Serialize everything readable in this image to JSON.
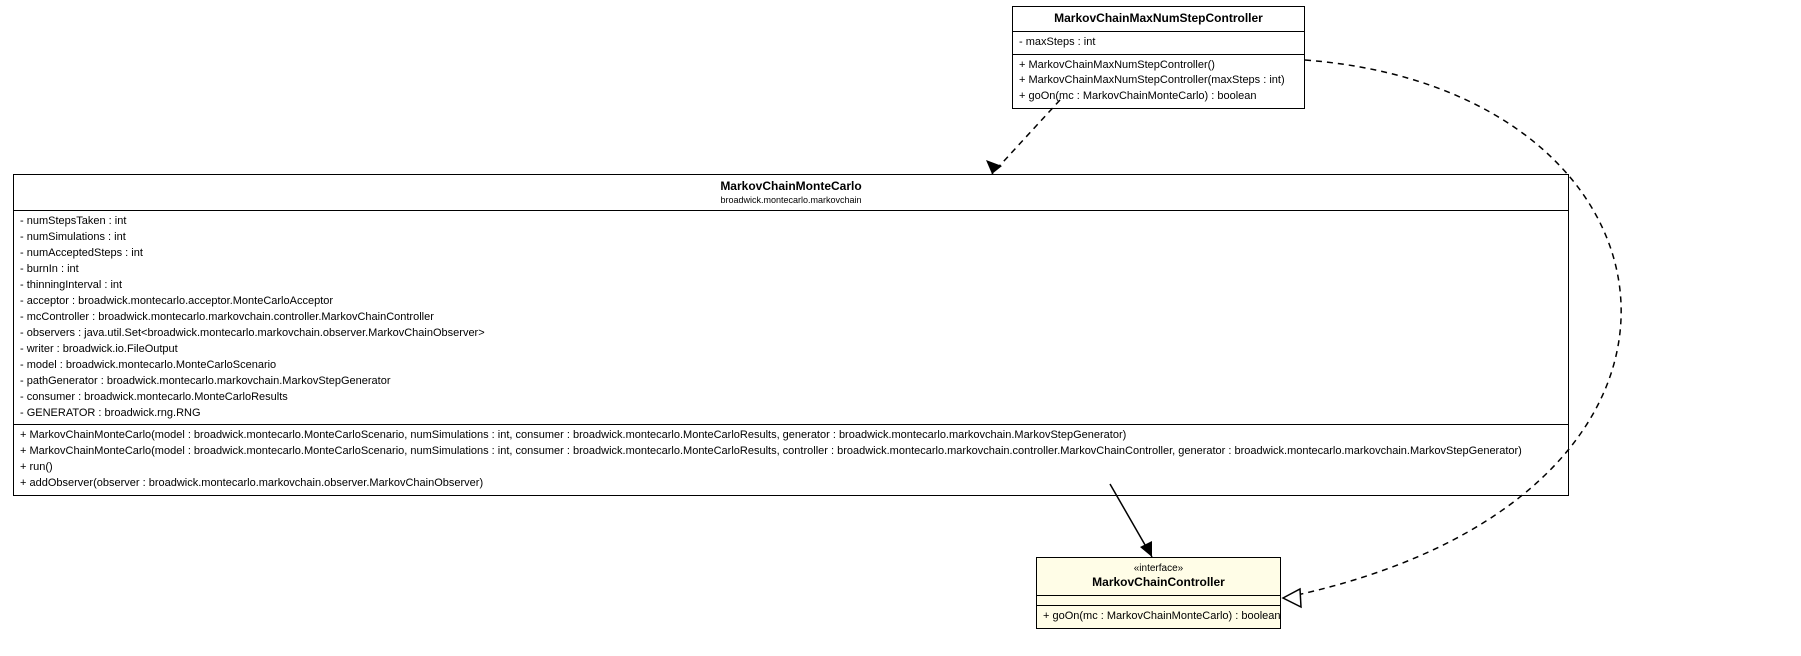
{
  "classes": {
    "maxStep": {
      "name": "MarkovChainMaxNumStepController",
      "attrs": [
        "- maxSteps : int"
      ],
      "ops": [
        "+ MarkovChainMaxNumStepController()",
        "+ MarkovChainMaxNumStepController(maxSteps : int)",
        "+ goOn(mc : MarkovChainMonteCarlo) : boolean"
      ]
    },
    "mcmc": {
      "name": "MarkovChainMonteCarlo",
      "pkg": "broadwick.montecarlo.markovchain",
      "attrs": [
        "- numStepsTaken : int",
        "- numSimulations : int",
        "- numAcceptedSteps : int",
        "- burnIn : int",
        "- thinningInterval : int",
        "- acceptor : broadwick.montecarlo.acceptor.MonteCarloAcceptor",
        "- mcController : broadwick.montecarlo.markovchain.controller.MarkovChainController",
        "- observers : java.util.Set<broadwick.montecarlo.markovchain.observer.MarkovChainObserver>",
        "- writer : broadwick.io.FileOutput",
        "- model : broadwick.montecarlo.MonteCarloScenario",
        "- pathGenerator : broadwick.montecarlo.markovchain.MarkovStepGenerator",
        "- consumer : broadwick.montecarlo.MonteCarloResults",
        "- GENERATOR : broadwick.rng.RNG"
      ],
      "ops": [
        "+ MarkovChainMonteCarlo(model : broadwick.montecarlo.MonteCarloScenario, numSimulations : int, consumer : broadwick.montecarlo.MonteCarloResults, generator : broadwick.montecarlo.markovchain.MarkovStepGenerator)",
        "+ MarkovChainMonteCarlo(model : broadwick.montecarlo.MonteCarloScenario, numSimulations : int, consumer : broadwick.montecarlo.MonteCarloResults, controller : broadwick.montecarlo.markovchain.controller.MarkovChainController, generator : broadwick.montecarlo.markovchain.MarkovStepGenerator)",
        "+ run()",
        "+ addObserver(observer : broadwick.montecarlo.markovchain.observer.MarkovChainObserver)"
      ]
    },
    "controller": {
      "stereo": "«interface»",
      "name": "MarkovChainController",
      "ops": [
        "+ goOn(mc : MarkovChainMonteCarlo) : boolean"
      ]
    }
  }
}
